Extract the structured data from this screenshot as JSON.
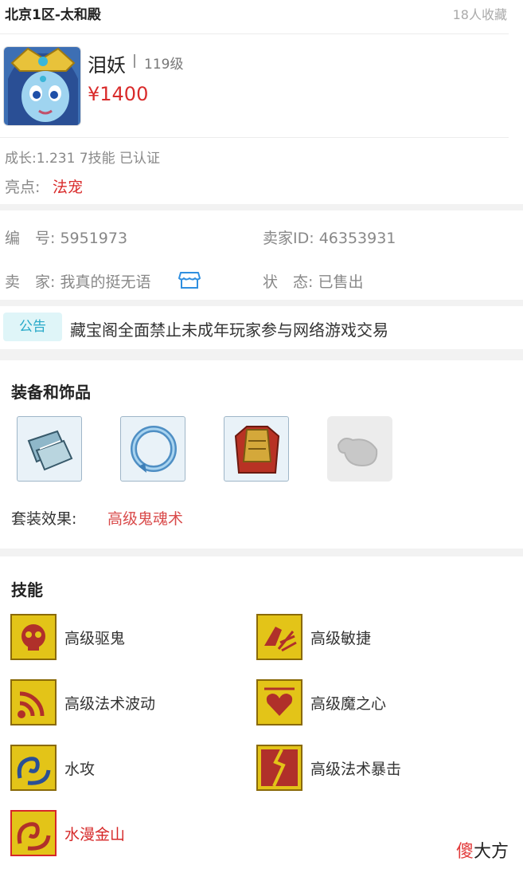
{
  "header": {
    "server": "北京1区-太和殿",
    "favorites": "18人收藏"
  },
  "pet": {
    "name": "泪妖",
    "level": "119级",
    "price": "¥1400",
    "growth_line": "成长:1.231 7技能 已认证",
    "highlight_label": "亮点:",
    "highlight_value": "法宠"
  },
  "info": {
    "id_label": "编　号:",
    "id_value": "5951973",
    "seller_id_label": "卖家ID:",
    "seller_id_value": "46353931",
    "seller_label": "卖　家:",
    "seller_value": "我真的挺无语",
    "status_label": "状　态:",
    "status_value": "已售出"
  },
  "notice": {
    "tag": "公告",
    "text": "藏宝阁全面禁止未成年玩家参与网络游戏交易"
  },
  "equipment": {
    "title": "装备和饰品",
    "items": [
      {
        "icon": "armguard-icon"
      },
      {
        "icon": "collar-icon"
      },
      {
        "icon": "armor-icon"
      },
      {
        "icon": "empty-slot-icon"
      }
    ],
    "set_label": "套装效果:",
    "set_value": "高级鬼魂术"
  },
  "skills": {
    "title": "技能",
    "items": [
      {
        "name": "高级驱鬼",
        "icon": "ghost-skull-icon"
      },
      {
        "name": "高级敏捷",
        "icon": "agility-icon"
      },
      {
        "name": "高级法术波动",
        "icon": "wave-icon"
      },
      {
        "name": "高级魔之心",
        "icon": "magic-heart-icon"
      },
      {
        "name": "水攻",
        "icon": "water-attack-icon"
      },
      {
        "name": "高级法术暴击",
        "icon": "critical-icon"
      },
      {
        "name": "水漫金山",
        "icon": "flood-icon",
        "special": true
      }
    ]
  },
  "watermark": {
    "red": "傻",
    "black": "大方"
  },
  "colors": {
    "price": "#d92b2b",
    "accent_cyan": "#27a9c8",
    "skill_gold": "#e3c418"
  }
}
